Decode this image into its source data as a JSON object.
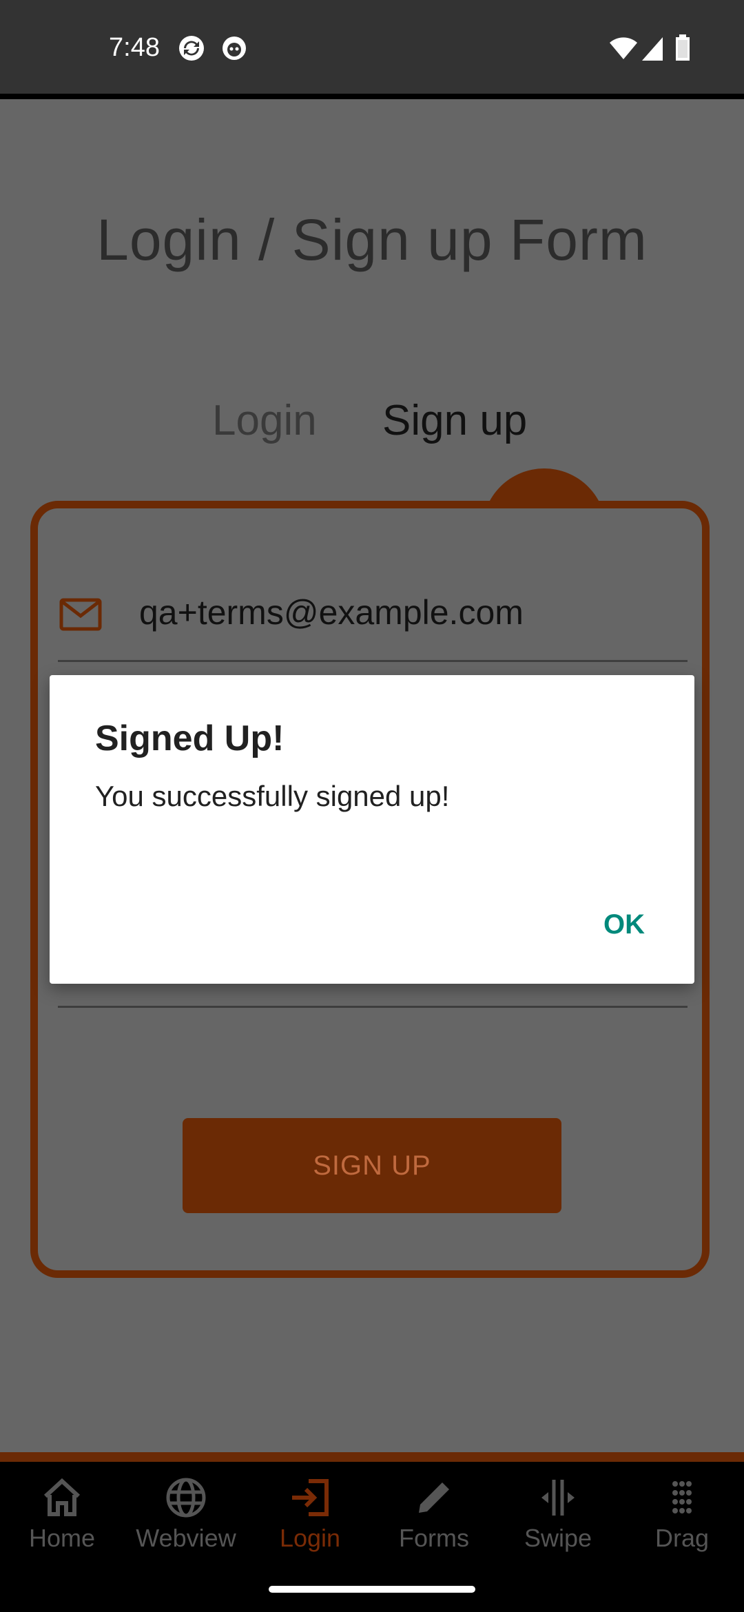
{
  "status_bar": {
    "time": "7:48",
    "left_icons": [
      "sync-icon",
      "app-notification-icon"
    ],
    "right_icons": [
      "wifi-icon",
      "cellular-signal-icon",
      "battery-icon"
    ]
  },
  "page": {
    "title": "Login / Sign up Form",
    "tabs": [
      {
        "label": "Login",
        "selected": false
      },
      {
        "label": "Sign up",
        "selected": true
      }
    ]
  },
  "form": {
    "email_icon": "mail-icon",
    "email_value": "qa+terms@example.com",
    "signup_button_label": "SIGN UP"
  },
  "dialog": {
    "title": "Signed Up!",
    "message": "You successfully signed up!",
    "ok_label": "OK"
  },
  "bottom_nav": {
    "items": [
      {
        "label": "Home",
        "icon": "home-icon",
        "active": false
      },
      {
        "label": "Webview",
        "icon": "globe-icon",
        "active": false
      },
      {
        "label": "Login",
        "icon": "login-icon",
        "active": true
      },
      {
        "label": "Forms",
        "icon": "pencil-icon",
        "active": false
      },
      {
        "label": "Swipe",
        "icon": "swipe-icon",
        "active": false
      },
      {
        "label": "Drag",
        "icon": "drag-grid-icon",
        "active": false
      }
    ]
  },
  "colors": {
    "accent": "#6b2a05",
    "dialog_button": "#00897b",
    "overlay_background": "#666666"
  }
}
